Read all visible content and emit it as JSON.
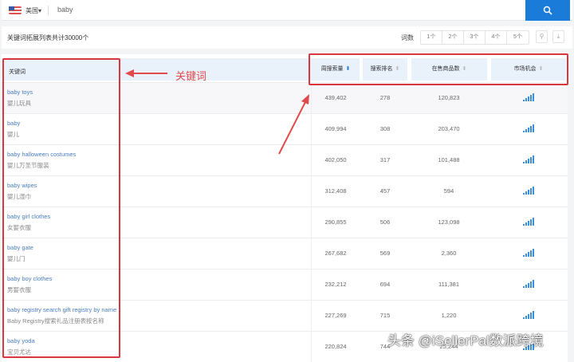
{
  "search": {
    "country": "美国▾",
    "query": "baby"
  },
  "toolbar": {
    "summary": "关键词拓展列表共计30000个",
    "word_count_label": "词数",
    "word_counts": [
      "1个",
      "2个",
      "3个",
      "4个",
      "5个"
    ]
  },
  "columns": {
    "keyword": "关键词",
    "weekly_search": "周搜索量",
    "search_rank": "搜索排名",
    "products": "在售商品数",
    "opportunity": "市场机会"
  },
  "annotation": {
    "label": "关键词"
  },
  "rows": [
    {
      "kw": "baby toys",
      "cn": "婴儿玩具",
      "search": "439,402",
      "rank": "278",
      "products": "120,823",
      "opportunity": 5
    },
    {
      "kw": "baby",
      "cn": "婴儿",
      "search": "409,994",
      "rank": "308",
      "products": "203,470",
      "opportunity": 5
    },
    {
      "kw": "baby halloween costumes",
      "cn": "婴儿万圣节服装",
      "search": "402,050",
      "rank": "317",
      "products": "101,488",
      "opportunity": 5
    },
    {
      "kw": "baby wipes",
      "cn": "婴儿湿巾",
      "search": "312,408",
      "rank": "457",
      "products": "594",
      "opportunity": 5
    },
    {
      "kw": "baby girl clothes",
      "cn": "女婴衣服",
      "search": "290,855",
      "rank": "506",
      "products": "123,098",
      "opportunity": 5
    },
    {
      "kw": "baby gate",
      "cn": "婴儿门",
      "search": "267,682",
      "rank": "569",
      "products": "2,360",
      "opportunity": 5
    },
    {
      "kw": "baby boy clothes",
      "cn": "男婴衣服",
      "search": "232,212",
      "rank": "694",
      "products": "111,381",
      "opportunity": 5
    },
    {
      "kw": "baby registry search gift registry by name",
      "cn": "Baby Registry搜索礼品注册表按名称",
      "search": "227,269",
      "rank": "715",
      "products": "1,220",
      "opportunity": 5
    },
    {
      "kw": "baby yoda",
      "cn": "宝贝尤达",
      "search": "220,824",
      "rank": "744",
      "products": "25,244",
      "opportunity": 5
    }
  ],
  "watermark": "头条 @iSellerPal数派跨境"
}
